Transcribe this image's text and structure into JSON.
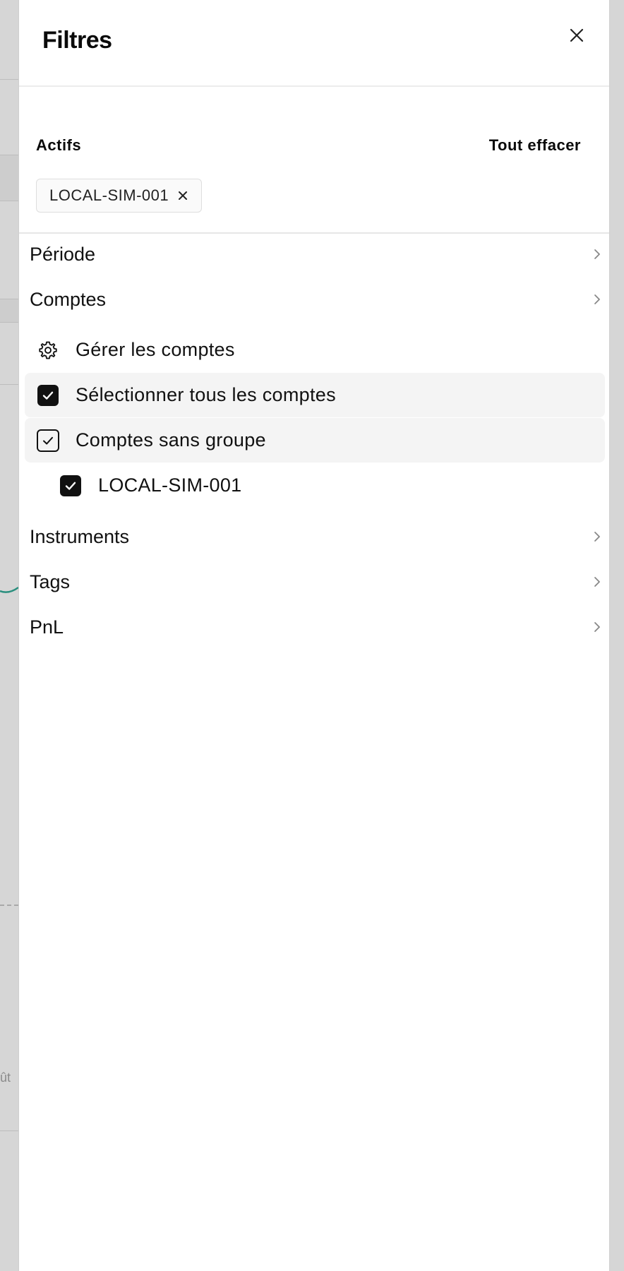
{
  "background": {
    "tick_text": "ût"
  },
  "sheet": {
    "title": "Filtres",
    "close_icon": "close-icon"
  },
  "active": {
    "label": "Actifs",
    "clear_all": "Tout effacer",
    "chips": [
      {
        "label": "LOCAL-SIM-001",
        "remove_icon": "close-icon"
      }
    ]
  },
  "sections": {
    "periode": "Période",
    "comptes": "Comptes",
    "instruments": "Instruments",
    "tags": "Tags",
    "pnl": "PnL"
  },
  "comptes": {
    "manage": {
      "label": "Gérer les comptes",
      "icon": "gear-icon"
    },
    "select_all": {
      "label": "Sélectionner tous les comptes",
      "checked": true
    },
    "ungrouped": {
      "label": "Comptes sans groupe",
      "checked": true
    },
    "accounts": [
      {
        "label": "LOCAL-SIM-001",
        "checked": true
      }
    ]
  },
  "colors": {
    "chart_line": "#2a8f7e",
    "checkbox": "#111111",
    "row_highlight": "#f4f4f4"
  }
}
